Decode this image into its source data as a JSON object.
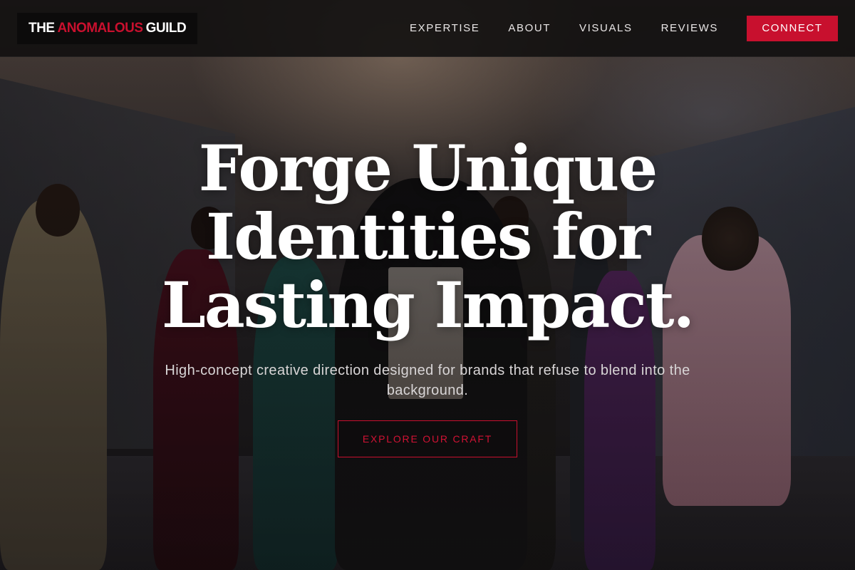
{
  "brand": {
    "part1": "THE",
    "part2": "ANOMALOUS",
    "part3": "GUILD"
  },
  "nav": {
    "items": [
      {
        "label": "EXPERTISE"
      },
      {
        "label": "ABOUT"
      },
      {
        "label": "VISUALS"
      },
      {
        "label": "REVIEWS"
      }
    ],
    "cta_label": "CONNECT"
  },
  "hero": {
    "title_lines": [
      "Forge Unique",
      "Identities for",
      "Lasting Impact."
    ],
    "subtitle": "High-concept creative direction designed for brands that refuse to blend into the background.",
    "cta_label": "EXPLORE OUR CRAFT",
    "background_image": "fashion-group-photo"
  },
  "colors": {
    "accent": "#c8102e",
    "header_bg": "#100f0f",
    "text": "#ffffff"
  }
}
